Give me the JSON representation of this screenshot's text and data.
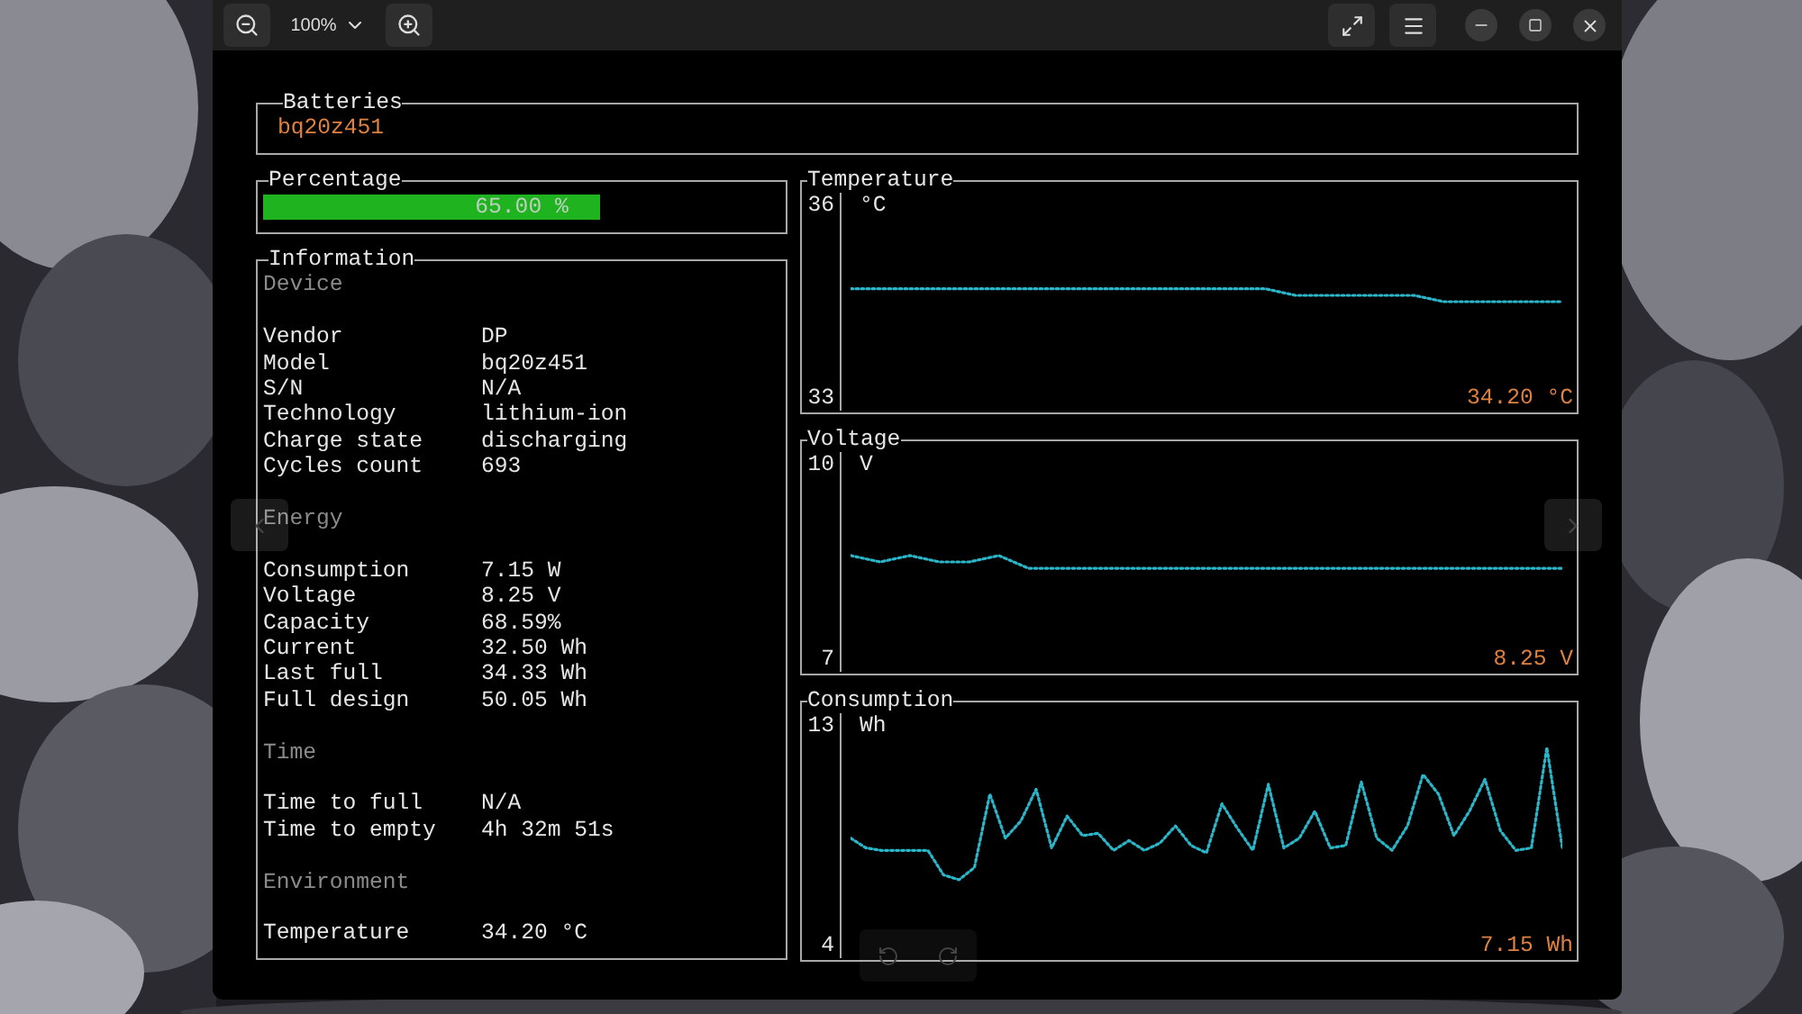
{
  "toolbar": {
    "zoom": "100%"
  },
  "batteries": {
    "title": "Batteries",
    "items": [
      {
        "name": "bq20z451",
        "selected": true
      }
    ]
  },
  "percentage": {
    "title": "Percentage",
    "level": 0.65,
    "reading": "65.00 %"
  },
  "information": {
    "title": "Information",
    "sections": [
      {
        "heading": "Device",
        "rows": [
          {
            "label": "Vendor",
            "value": "DP"
          },
          {
            "label": "Model",
            "value": "bq20z451"
          },
          {
            "label": "S/N",
            "value": "N/A"
          },
          {
            "label": "Technology",
            "value": "lithium-ion"
          },
          {
            "label": "Charge state",
            "value": "discharging"
          },
          {
            "label": "Cycles count",
            "value": "693"
          }
        ]
      },
      {
        "heading": "Energy",
        "rows": [
          {
            "label": "Consumption",
            "value": "7.15 W"
          },
          {
            "label": "Voltage",
            "value": "8.25 V"
          },
          {
            "label": "Capacity",
            "value": "68.59%"
          },
          {
            "label": "Current",
            "value": "32.50 Wh"
          },
          {
            "label": "Last full",
            "value": "34.33 Wh"
          },
          {
            "label": "Full design",
            "value": "50.05 Wh"
          }
        ]
      },
      {
        "heading": "Time",
        "rows": [
          {
            "label": "Time to full",
            "value": "N/A"
          },
          {
            "label": "Time to empty",
            "value": "4h 32m 51s"
          }
        ]
      },
      {
        "heading": "Environment",
        "rows": [
          {
            "label": "Temperature",
            "value": "34.20 °C"
          }
        ]
      }
    ]
  },
  "charts": [
    {
      "title": "Temperature",
      "unit": "°C",
      "reading": "34.20 °C",
      "chart_data": {
        "type": "line",
        "ylim": [
          32.8,
          36.2
        ],
        "yticks": [
          33,
          36
        ],
        "series": [
          {
            "color": "#2bb5c8",
            "line_style": "dotted",
            "values": [
              34.7,
              34.7,
              34.7,
              34.7,
              34.7,
              34.7,
              34.7,
              34.7,
              34.7,
              34.7,
              34.7,
              34.7,
              34.7,
              34.7,
              34.7,
              34.6,
              34.6,
              34.6,
              34.6,
              34.6,
              34.5,
              34.5,
              34.5,
              34.5,
              34.5
            ]
          }
        ]
      }
    },
    {
      "title": "Voltage",
      "unit": "V",
      "reading": "8.25 V",
      "chart_data": {
        "type": "line",
        "ylim": [
          6.8,
          10.2
        ],
        "yticks": [
          7,
          10
        ],
        "series": [
          {
            "color": "#2bb5c8",
            "line_style": "dotted",
            "values": [
              8.6,
              8.5,
              8.6,
              8.5,
              8.5,
              8.6,
              8.4,
              8.4,
              8.4,
              8.4,
              8.4,
              8.4,
              8.4,
              8.4,
              8.4,
              8.4,
              8.4,
              8.4,
              8.4,
              8.4,
              8.4,
              8.4,
              8.4,
              8.4,
              8.4
            ]
          }
        ]
      }
    },
    {
      "title": "Consumption",
      "unit": "Wh",
      "reading": "7.15 Wh",
      "chart_data": {
        "type": "line",
        "ylim": [
          3.5,
          13.5
        ],
        "yticks": [
          4,
          13
        ],
        "series": [
          {
            "color": "#2bb5c8",
            "line_style": "dotted",
            "values": [
              8.4,
              8.0,
              7.9,
              7.9,
              7.9,
              7.9,
              6.9,
              6.7,
              7.2,
              10.2,
              8.4,
              9.1,
              10.4,
              8.0,
              9.3,
              8.5,
              8.6,
              7.9,
              8.3,
              7.9,
              8.2,
              8.9,
              8.1,
              7.8,
              9.8,
              8.8,
              7.9,
              10.6,
              8.0,
              8.4,
              9.5,
              8.0,
              8.1,
              10.7,
              8.4,
              7.9,
              8.9,
              11.0,
              10.2,
              8.5,
              9.5,
              10.8,
              8.7,
              7.9,
              8.0,
              12.1,
              8.0
            ]
          }
        ]
      }
    }
  ]
}
